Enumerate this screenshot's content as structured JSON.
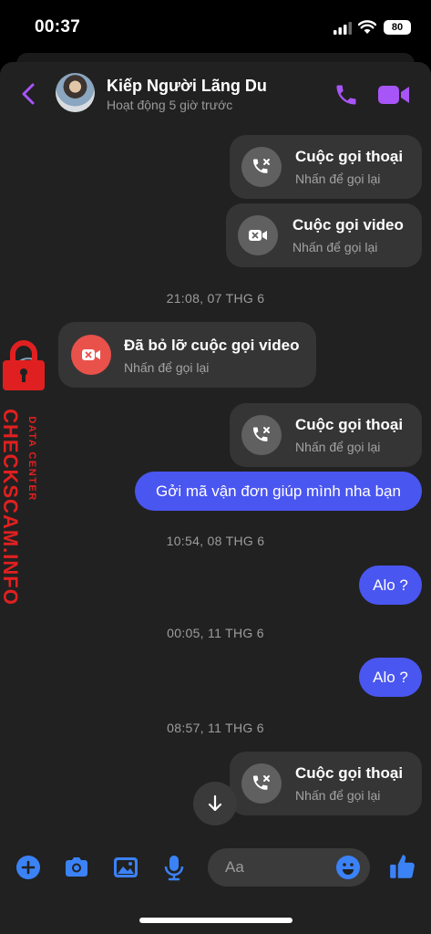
{
  "status_bar": {
    "time": "00:37",
    "battery": "80"
  },
  "header": {
    "name": "Kiếp Người Lãng Du",
    "status": "Hoạt động 5 giờ trước"
  },
  "messages": {
    "call1": {
      "title": "Cuộc gọi thoại",
      "sub": "Nhấn để gọi lại",
      "icon": "missed-voice-call-icon"
    },
    "call2": {
      "title": "Cuộc gọi video",
      "sub": "Nhấn để gọi lại",
      "icon": "missed-video-call-icon"
    },
    "ts1": "21:08, 07 THG 6",
    "call3": {
      "title": "Đã bỏ lỡ cuộc gọi video",
      "sub": "Nhấn để gọi lại",
      "icon": "missed-video-call-icon"
    },
    "call4": {
      "title": "Cuộc gọi thoại",
      "sub": "Nhấn để gọi lại",
      "icon": "missed-voice-call-icon"
    },
    "msg1": "Gởi mã vận đơn giúp mình nha bạn",
    "ts2": "10:54, 08 THG 6",
    "msg2": "Alo ?",
    "ts3": "00:05, 11 THG 6",
    "msg3": "Alo ?",
    "ts4": "08:57, 11 THG 6",
    "call5": {
      "title": "Cuộc gọi thoại",
      "sub": "Nhấn để gọi lại",
      "icon": "missed-voice-call-icon"
    }
  },
  "composer": {
    "placeholder": "Aa"
  },
  "watermark": {
    "main": "CHECKSCAM.INFO",
    "sub": "DATA CENTER"
  },
  "colors": {
    "accent": "#a855f7",
    "bubble_out": "#4a56f0",
    "missed": "#e9514b",
    "toolbar": "#3b82f6"
  }
}
